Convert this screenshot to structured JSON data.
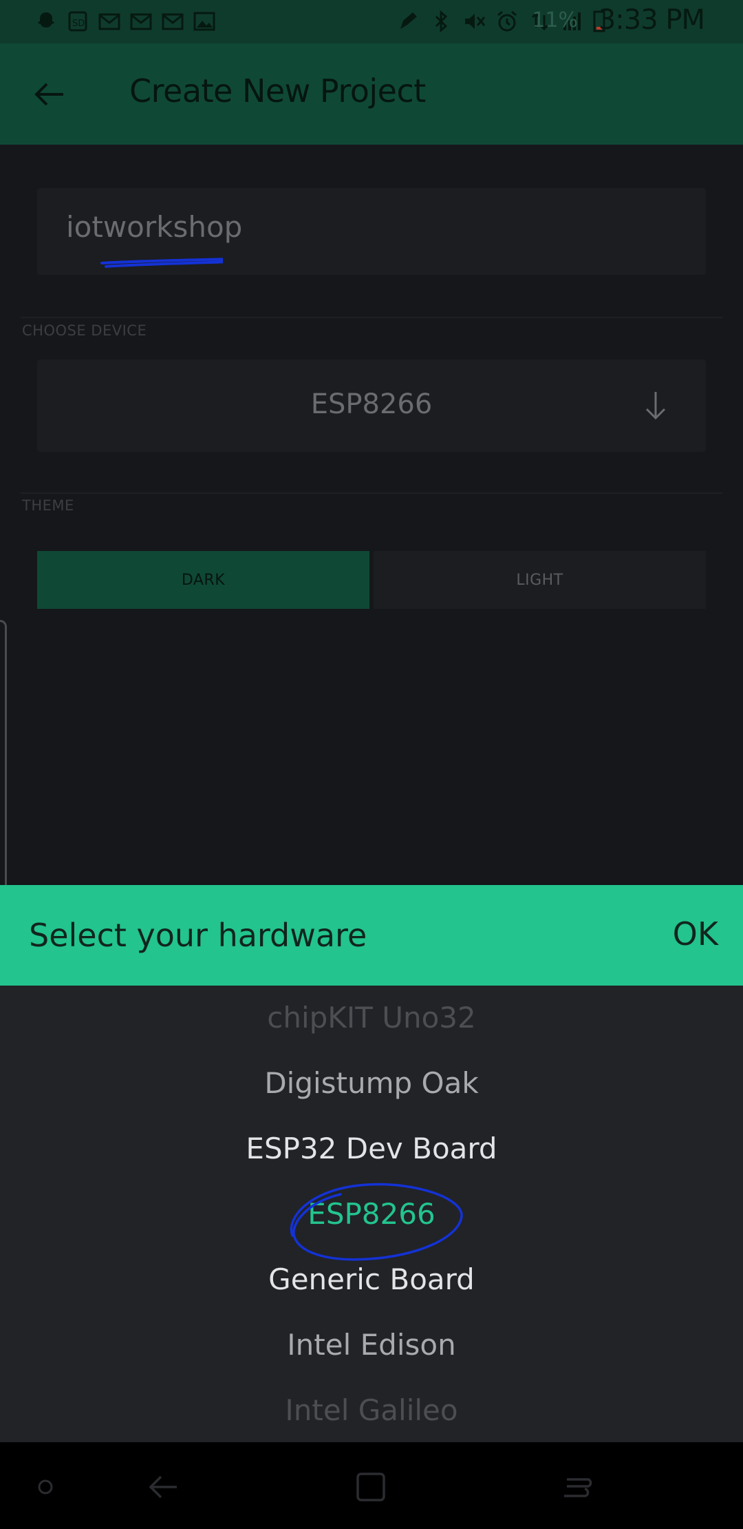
{
  "status_bar": {
    "time": "3:33 PM",
    "battery_percent": "11%",
    "left_icons": [
      "snapchat-icon",
      "sd-icon",
      "mail-icon",
      "mail-icon",
      "mail-icon",
      "image-icon"
    ],
    "right_icons": [
      "pen-icon",
      "bluetooth-icon",
      "mute-icon",
      "alarm-icon",
      "data-icon",
      "signal-icon",
      "battery-icon"
    ]
  },
  "app_bar": {
    "title": "Create New Project",
    "back_icon": "back-arrow-icon"
  },
  "form": {
    "project_name": "iotworkshop",
    "choose_device_label": "CHOOSE DEVICE",
    "device_value": "ESP8266",
    "device_icon": "arrow-down-icon",
    "theme_label": "THEME",
    "theme_options": [
      "DARK",
      "LIGHT"
    ],
    "theme_selected": "DARK"
  },
  "picker": {
    "title": "Select your hardware",
    "ok_label": "OK",
    "items": [
      {
        "label": "chipKIT Uno32"
      },
      {
        "label": "Digistump Oak"
      },
      {
        "label": "ESP32 Dev Board"
      },
      {
        "label": "ESP8266"
      },
      {
        "label": "Generic Board"
      },
      {
        "label": "Intel Edison"
      },
      {
        "label": "Intel Galileo"
      }
    ],
    "selected": "ESP8266"
  },
  "colors": {
    "accent": "#23c48e",
    "app_bar": "#0f4935",
    "selected_item": "#23c48e",
    "annotation": "#1432d6"
  },
  "nav_bar": {
    "icons": [
      "dot-icon",
      "back-icon",
      "home-icon",
      "recents-icon"
    ]
  }
}
